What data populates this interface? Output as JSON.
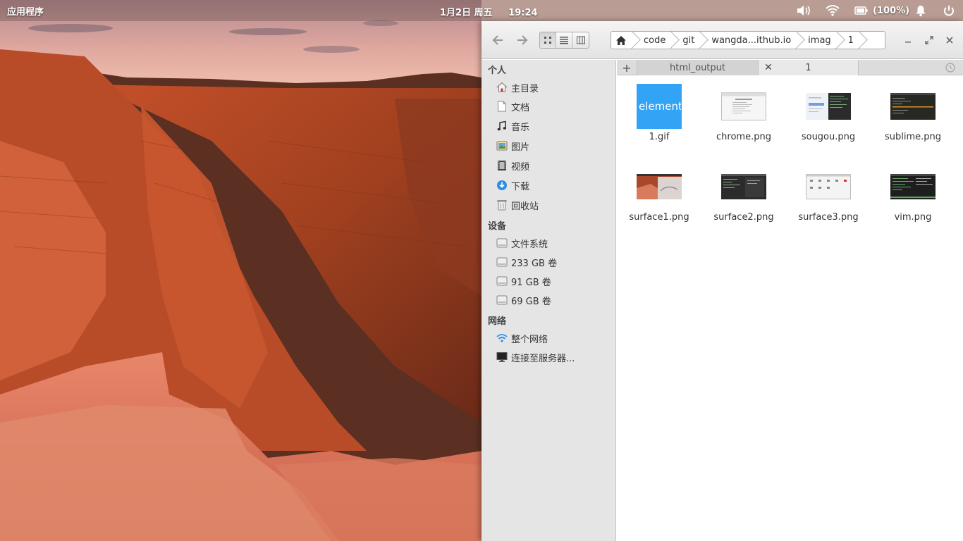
{
  "panel": {
    "applications": "应用程序",
    "date": "1月2日 周五",
    "time": "19:24",
    "battery": "(100%)"
  },
  "toolbar": {
    "breadcrumbs": [
      "code",
      "git",
      "wangda...ithub.io",
      "imag",
      "1"
    ]
  },
  "sidebar": {
    "personal_header": "个人",
    "personal": [
      {
        "label": "主目录",
        "icon": "home-icon"
      },
      {
        "label": "文档",
        "icon": "document-icon"
      },
      {
        "label": "音乐",
        "icon": "music-icon"
      },
      {
        "label": "图片",
        "icon": "pictures-icon"
      },
      {
        "label": "视频",
        "icon": "video-icon"
      },
      {
        "label": "下载",
        "icon": "download-icon"
      },
      {
        "label": "回收站",
        "icon": "trash-icon"
      }
    ],
    "devices_header": "设备",
    "devices": [
      {
        "label": "文件系统",
        "icon": "drive-icon"
      },
      {
        "label": "233 GB 卷",
        "icon": "drive-icon"
      },
      {
        "label": "91 GB 卷",
        "icon": "drive-icon"
      },
      {
        "label": "69 GB 卷",
        "icon": "drive-icon"
      }
    ],
    "network_header": "网络",
    "network": [
      {
        "label": "整个网络",
        "icon": "network-icon"
      },
      {
        "label": "连接至服务器...",
        "icon": "server-icon"
      }
    ]
  },
  "tabs": [
    {
      "label": "html_output"
    },
    {
      "label": "1"
    }
  ],
  "files": [
    {
      "name": "1.gif",
      "thumb_text": "elementa"
    },
    {
      "name": "chrome.png"
    },
    {
      "name": "sougou.png"
    },
    {
      "name": "sublime.png"
    },
    {
      "name": "surface1.png"
    },
    {
      "name": "surface2.png"
    },
    {
      "name": "surface3.png"
    },
    {
      "name": "vim.png"
    }
  ],
  "colors": {
    "accent": "#33a3f5",
    "sidebar_bg": "#e5e5e5"
  }
}
